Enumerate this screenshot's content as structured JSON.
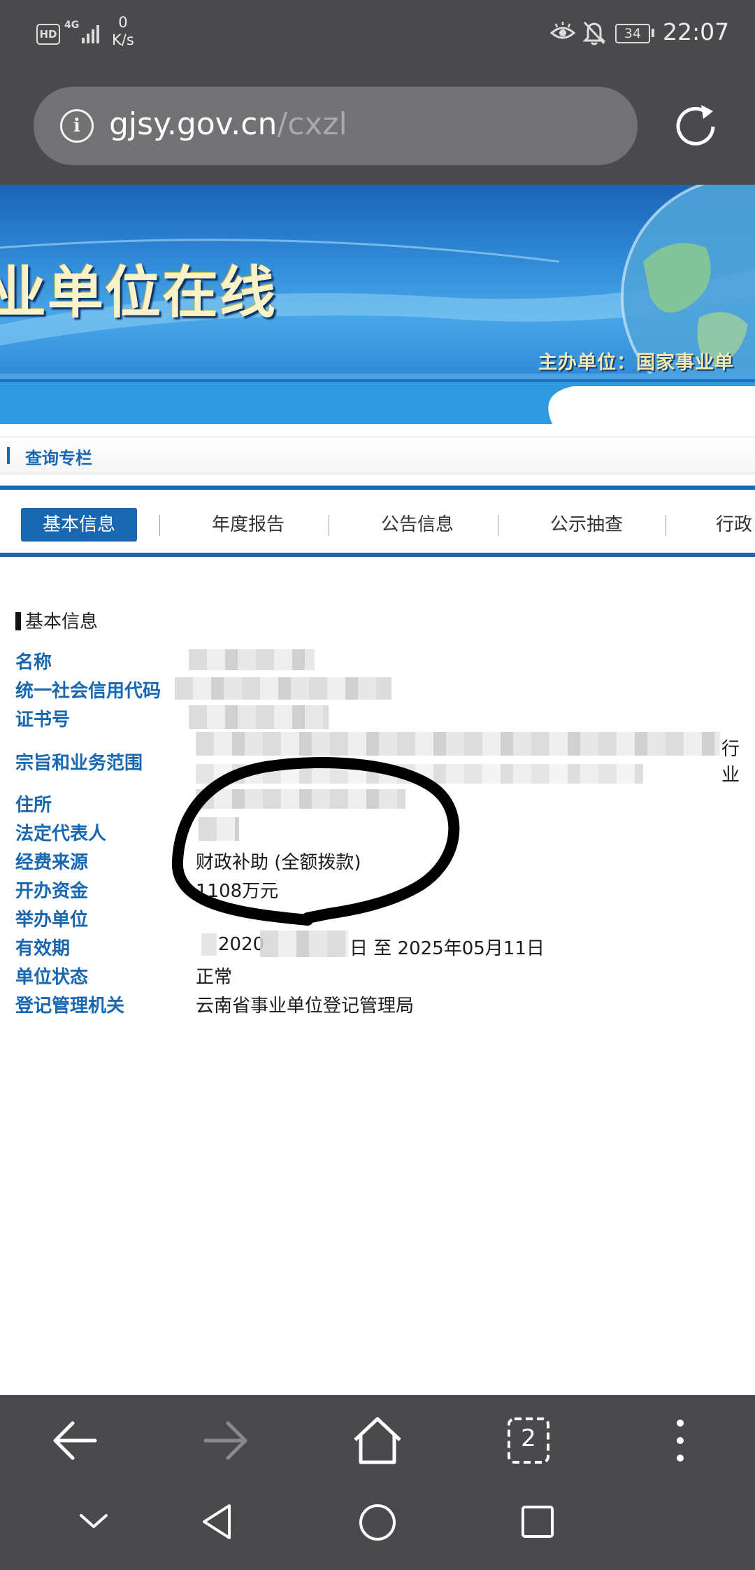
{
  "status_bar": {
    "hd_badge": "HD",
    "network": "4G",
    "speed_value": "0",
    "speed_unit": "K/s",
    "battery": "34",
    "time": "22:07"
  },
  "browser": {
    "url_domain": "gjsy.gov.cn",
    "url_path": "/cxzl",
    "tabs_count": "2"
  },
  "banner": {
    "title": "业单位在线",
    "sponsor": "主办单位：国家事业单"
  },
  "query_section": {
    "title": "查询专栏"
  },
  "tabs": [
    {
      "label": "基本信息",
      "active": true
    },
    {
      "label": "年度报告",
      "active": false
    },
    {
      "label": "公告信息",
      "active": false
    },
    {
      "label": "公示抽查",
      "active": false
    },
    {
      "label": "行政",
      "active": false
    }
  ],
  "basic_info": {
    "heading": "基本信息",
    "fields": [
      {
        "label": "名称",
        "value": ""
      },
      {
        "label": "统一社会信用代码",
        "value": ""
      },
      {
        "label": "证书号",
        "value": ""
      },
      {
        "label": "宗旨和业务范围",
        "value": "",
        "value_tail": "行业"
      },
      {
        "label": "住所",
        "value": ""
      },
      {
        "label": "法定代表人",
        "value": ""
      },
      {
        "label": "经费来源",
        "value": "财政补助 (全额拨款)"
      },
      {
        "label": "开办资金",
        "value": "1108万元"
      },
      {
        "label": "举办单位",
        "value": ""
      },
      {
        "label": "有效期",
        "value_start": "2020",
        "value_end": "日 至 2025年05月11日"
      },
      {
        "label": "单位状态",
        "value": "正常"
      },
      {
        "label": "登记管理机关",
        "value": "云南省事业单位登记管理局"
      }
    ]
  },
  "icons": {
    "signal": "signal-bars-icon",
    "eye": "eye-comfort-icon",
    "bell": "bell-off-icon",
    "info": "info-icon",
    "reload": "reload-icon",
    "back": "back-arrow-icon",
    "forward": "forward-arrow-icon",
    "home": "home-icon",
    "tabs": "tabs-icon",
    "menu": "more-vertical-icon"
  },
  "colors": {
    "brand_blue": "#1a67b1",
    "chrome_gray": "#4a4a4c"
  }
}
